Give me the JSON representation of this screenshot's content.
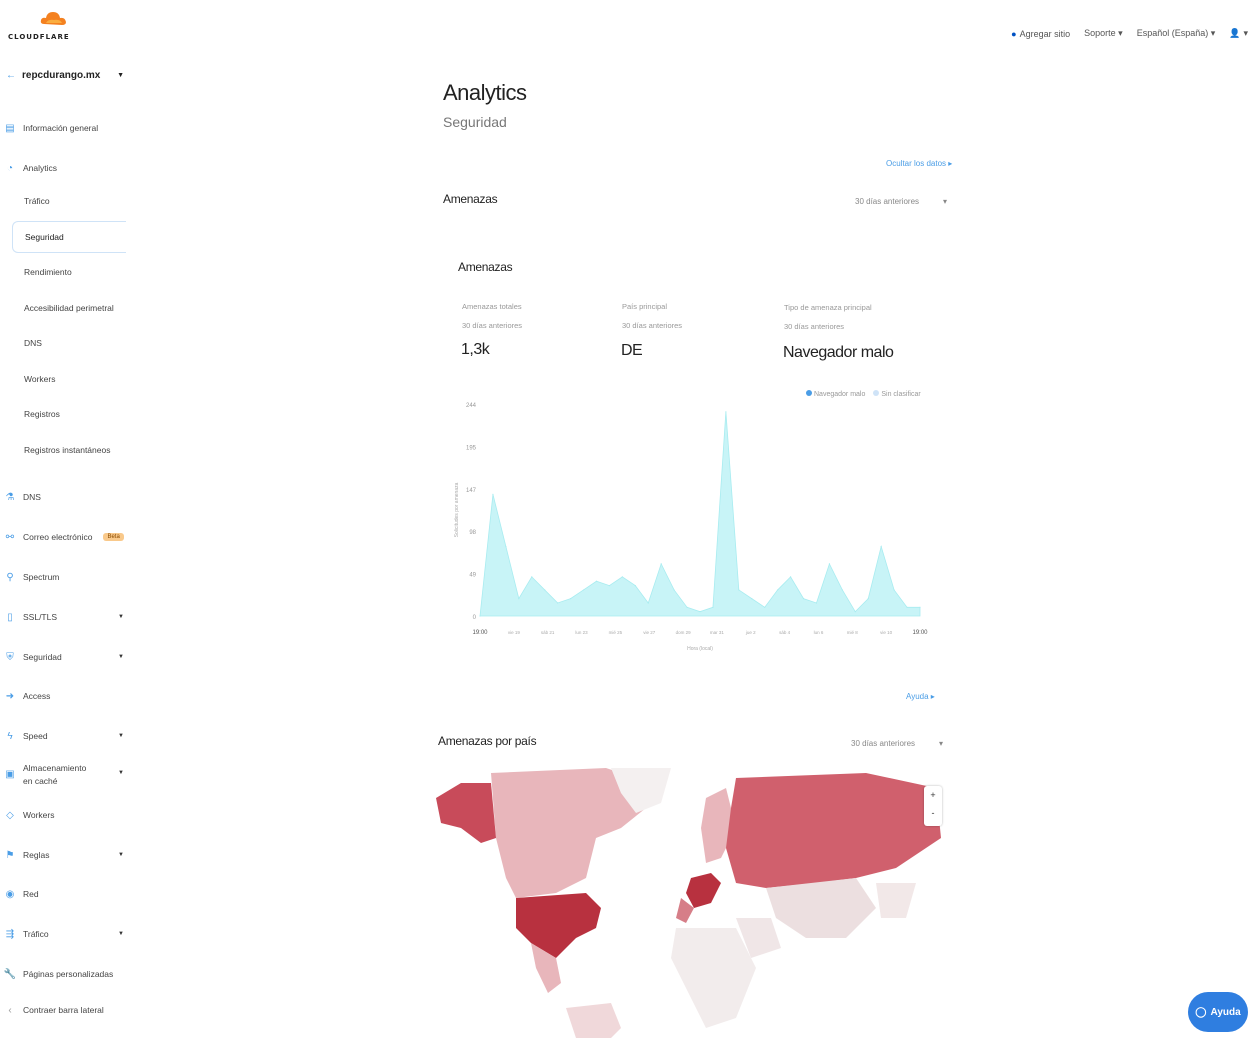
{
  "brand": {
    "wordmark": "CLOUDFLARE"
  },
  "topnav": {
    "add_site": "Agregar sitio",
    "support": "Soporte ▾",
    "language": "Español (España) ▾",
    "user": "▾"
  },
  "sidebar": {
    "account": "repcdurango.mx",
    "items": [
      {
        "label": "Información general"
      },
      {
        "label": "Analytics"
      },
      {
        "label": "DNS"
      },
      {
        "label": "Correo electrónico",
        "badge": "Beta"
      },
      {
        "label": "Spectrum"
      },
      {
        "label": "SSL/TLS"
      },
      {
        "label": "Seguridad"
      },
      {
        "label": "Access"
      },
      {
        "label": "Speed"
      },
      {
        "label": "Almacenamiento en caché"
      },
      {
        "label": "Workers"
      },
      {
        "label": "Reglas"
      },
      {
        "label": "Red"
      },
      {
        "label": "Tráfico"
      },
      {
        "label": "Páginas personalizadas"
      },
      {
        "label": "Contraer barra lateral"
      }
    ],
    "analytics_sub": [
      "Tráfico",
      "Seguridad",
      "Rendimiento",
      "Accesibilidad perimetral",
      "DNS",
      "Workers",
      "Registros",
      "Registros instantáneos"
    ]
  },
  "page": {
    "title": "Analytics",
    "subtitle": "Seguridad",
    "view_data_link": "Ocultar los datos ▸",
    "threats_section": "Amenazas",
    "range_select": "30 días anteriores",
    "card_title": "Amenazas",
    "stats": [
      {
        "label": "Amenazas totales",
        "sublabel": "30 días anteriores",
        "value": "1,3k"
      },
      {
        "label": "País principal",
        "sublabel": "30 días anteriores",
        "value": "DE"
      },
      {
        "label": "Tipo de amenaza principal",
        "sublabel": "30 días anteriores",
        "value": "Navegador malo"
      }
    ],
    "help_link": "Ayuda ▸",
    "map_section": "Amenazas por país",
    "map_range": "30 días anteriores",
    "help_button": "Ayuda"
  },
  "chart_data": {
    "type": "area",
    "ylim": [
      0,
      244
    ],
    "yticks": [
      "0",
      "49",
      "98",
      "147",
      "195",
      "244"
    ],
    "xtick_labels": [
      "19:00",
      "vie 19",
      "sáb 21",
      "lun 23",
      "mié 25",
      "vie 27",
      "dom 29",
      "mar 31",
      "jue 2",
      "sáb 4",
      "lun 6",
      "mié 8",
      "vie 10",
      "19:00"
    ],
    "xlabel": "Hora (local)",
    "ylabel": "Solicitudes por amenaza",
    "series": [
      {
        "name": "Navegador malo",
        "values": [
          0,
          140,
          80,
          20,
          45,
          30,
          15,
          20,
          30,
          40,
          35,
          45,
          35,
          15,
          60,
          30,
          10,
          5,
          10,
          235,
          30,
          20,
          10,
          30,
          45,
          20,
          15,
          60,
          30,
          5,
          20,
          80,
          30,
          10,
          10
        ]
      }
    ],
    "legend": [
      "Navegador malo",
      "Sin clasificar"
    ],
    "colors": {
      "fill": "#c8f4f7",
      "line": "#a8ecf0"
    }
  },
  "map_data": {
    "zoom_in": "+",
    "zoom_out": "-"
  }
}
